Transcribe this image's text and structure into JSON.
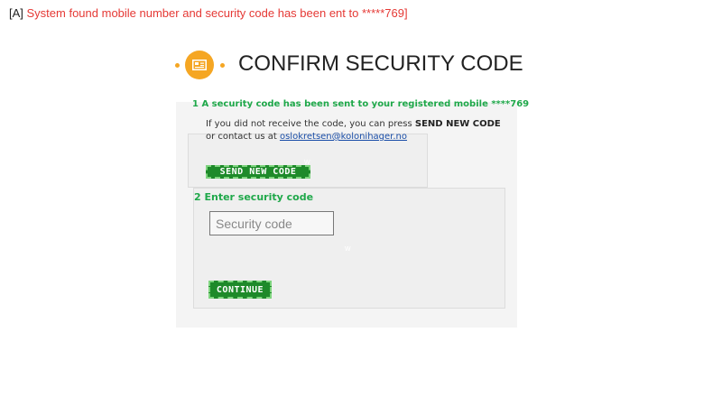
{
  "annotation": {
    "prefix": "[A] ",
    "message": "System found mobile number and security code has been ent to *****769]"
  },
  "header": {
    "title": "CONFIRM SECURITY CODE",
    "icon": "id-card-icon",
    "accent_color": "#f5a623"
  },
  "step1": {
    "label": "1  A security code has been sent to your registered mobile ****769",
    "text_before": "If you did not receive the code, you can press ",
    "text_bold": "SEND NEW CODE",
    "text_middle": " or contact us at ",
    "email": "oslokretsen@kolonihager.no",
    "button_label": "SEND NEW CODE"
  },
  "step2": {
    "label": "2  Enter security code",
    "input_placeholder": "Security code",
    "button_label": "CONTINUE"
  },
  "colors": {
    "step_label": "#1fa84a",
    "button_bg": "#1e8a2a",
    "annotation_red": "#e53935"
  }
}
